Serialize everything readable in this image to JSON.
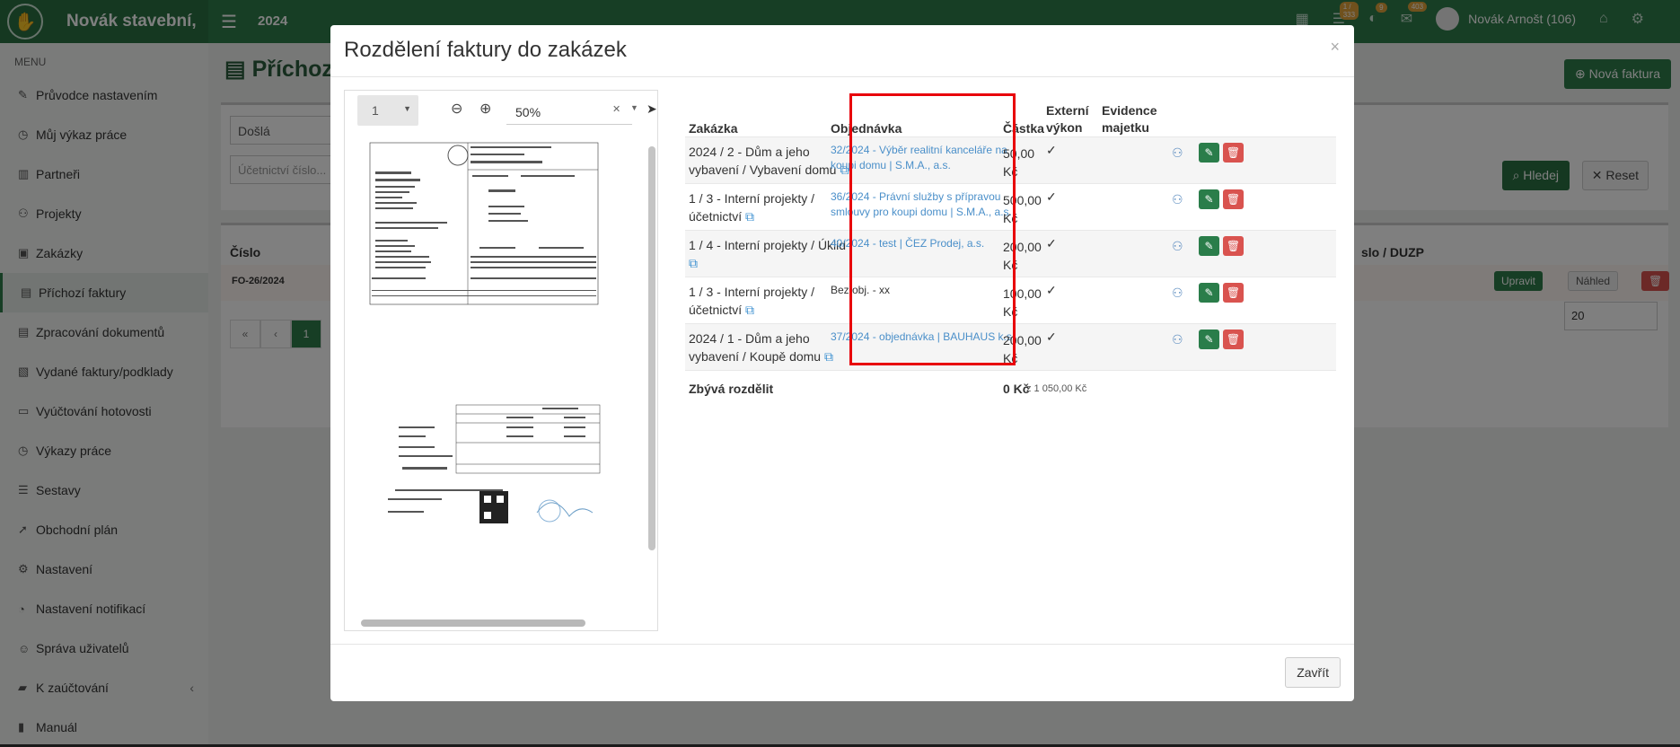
{
  "topbar": {
    "brand": "Novák stavební,",
    "year": "2024",
    "badges": [
      "1 / 333",
      "9",
      "403"
    ],
    "user": "Novák Arnošt (106)"
  },
  "sidebar": {
    "menu_heading": "MENU",
    "items": [
      {
        "label": "Průvodce nastavením",
        "icon": "pencil-icon"
      },
      {
        "label": "Můj výkaz práce",
        "icon": "clock-icon"
      },
      {
        "label": "Partneři",
        "icon": "building-icon"
      },
      {
        "label": "Projekty",
        "icon": "sitemap-icon"
      },
      {
        "label": "Zakázky",
        "icon": "box-icon"
      },
      {
        "label": "Příchozí faktury",
        "icon": "file-icon"
      },
      {
        "label": "Zpracování dokumentů",
        "icon": "file-icon"
      },
      {
        "label": "Vydané faktury/podklady",
        "icon": "invoice-icon"
      },
      {
        "label": "Vyúčtování hotovosti",
        "icon": "money-icon"
      },
      {
        "label": "Výkazy práce",
        "icon": "clock-icon"
      },
      {
        "label": "Sestavy",
        "icon": "list-icon"
      },
      {
        "label": "Obchodní plán",
        "icon": "rocket-icon"
      },
      {
        "label": "Nastavení",
        "icon": "gears-icon"
      },
      {
        "label": "Nastavení notifikací",
        "icon": "bell-icon"
      },
      {
        "label": "Správa uživatelů",
        "icon": "users-icon"
      },
      {
        "label": "K zaúčtování",
        "icon": "folder-icon"
      },
      {
        "label": "Manuál",
        "icon": "book-icon"
      }
    ]
  },
  "page": {
    "title": "Příchozí",
    "new_button": "Nová faktura",
    "filter_select": "Došlá",
    "filter_input_placeholder": "Účetnictví číslo...",
    "search_button": "Hledej",
    "reset_button": "Reset",
    "col_cislo": "Číslo",
    "col_duzp": "slo / DUZP",
    "row_id": "FO-26/2024",
    "upravit": "Upravit",
    "nahled": "Náhled",
    "pager": [
      "«",
      "‹",
      "1"
    ],
    "per_page": "20"
  },
  "modal": {
    "title": "Rozdělení faktury do zakázek",
    "close_button": "Zavřít",
    "viewer": {
      "page_select": "1",
      "zoom": "50%"
    },
    "table": {
      "headers": {
        "zakazka": "Zakázka",
        "objednavka": "Objednávka",
        "castka": "Částka",
        "externi": "Externí výkon",
        "evidence": "Evidence majetku"
      },
      "rows": [
        {
          "zakazka": "2024 / 2 - Dům a jeho vybavení / Vybavení domu",
          "objednavka": "32/2024 - Výběr realitní kanceláře na koupi domu | S.M.A., a.s.",
          "castka": "50,00 Kč",
          "linked": true
        },
        {
          "zakazka": "1 / 3 - Interní projekty / účetnictví",
          "objednavka": "36/2024 - Právní služby s přípravou smlouvy pro koupi domu | S.M.A., a.s.",
          "castka": "500,00 Kč",
          "linked": true
        },
        {
          "zakazka": "1 / 4 - Interní projekty / Úklid",
          "objednavka": "40/2024 - test | ČEZ Prodej, a.s.",
          "castka": "200,00 Kč",
          "linked": true
        },
        {
          "zakazka": "1 / 3 - Interní projekty / účetnictví",
          "objednavka": "Bez obj. - xx",
          "castka": "100,00 Kč",
          "linked": false
        },
        {
          "zakazka": "2024 / 1 - Dům a jeho vybavení / Koupě domu",
          "objednavka": "37/2024 - objednávka | BAUHAUS k.s.",
          "castka": "200,00 Kč",
          "linked": true
        }
      ],
      "summary": {
        "label": "Zbývá rozdělit",
        "amount": "0 Kč",
        "total": "z 1 050,00 Kč"
      }
    }
  }
}
